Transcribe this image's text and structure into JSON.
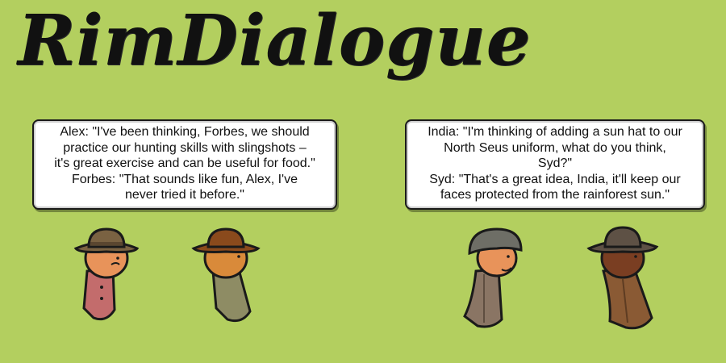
{
  "title": "RimDialogue",
  "conversations": [
    {
      "lines": [
        "Alex: \"I've been thinking, Forbes, we should",
        "practice our hunting skills with slingshots –",
        "it's great exercise and can be useful for food.\"",
        "Forbes: \"That sounds like fun, Alex, I've",
        "never tried it before.\""
      ]
    },
    {
      "lines": [
        "India: \"I'm thinking of adding a sun hat to our",
        "North Seus uniform, what do you think,",
        "Syd?\"",
        "Syd: \"That's a great idea, India, it'll keep our",
        "faces protected from the rainforest sun.\""
      ]
    }
  ],
  "pawns": [
    {
      "head_icon": "cowboy-hat-icon",
      "skin": "#e8935a",
      "hat": "#7a6242",
      "body": "#c36c6c"
    },
    {
      "head_icon": "cowboy-hat-icon",
      "skin": "#d98a3a",
      "hat": "#8a4a1c",
      "body": "#8e8c64"
    },
    {
      "head_icon": "helmet-icon",
      "skin": "#e8935a",
      "hat": "#6e6e66",
      "body": "#8a7564"
    },
    {
      "head_icon": "cowboy-hat-icon",
      "skin": "#7a3e22",
      "hat": "#5e5145",
      "body": "#8a5a34"
    }
  ],
  "colors": {
    "background": "#b3cf5f",
    "bubble": "#ffffff",
    "outline": "#1a1a1a"
  }
}
